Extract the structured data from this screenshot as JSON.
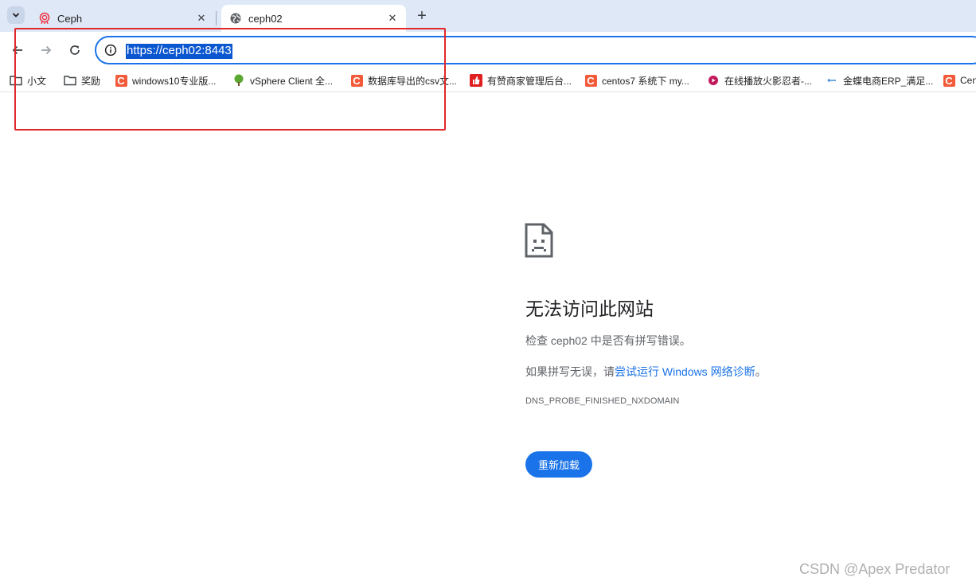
{
  "tabs": [
    {
      "title": "Ceph",
      "favicon": "ceph-icon",
      "active": false
    },
    {
      "title": "ceph02",
      "favicon": "globe-icon",
      "active": true
    }
  ],
  "tab_close_glyph": "✕",
  "new_tab_glyph": "+",
  "toolbar": {
    "url": "https://ceph02:8443",
    "security_icon": "info-icon"
  },
  "bookmarks": [
    {
      "label": "小文",
      "icon": "folder-icon"
    },
    {
      "label": "奖励",
      "icon": "folder-icon"
    },
    {
      "label": "windows10专业版...",
      "icon": "csdn-c-icon"
    },
    {
      "label": "vSphere Client 全...",
      "icon": "tree-icon"
    },
    {
      "label": "数据库导出的csv文...",
      "icon": "csdn-c-icon"
    },
    {
      "label": "有赞商家管理后台...",
      "icon": "thumbs-up-icon"
    },
    {
      "label": "centos7 系统下 my...",
      "icon": "csdn-c-icon"
    },
    {
      "label": "在线播放火影忍者-...",
      "icon": "play-icon"
    },
    {
      "label": "金蝶电商ERP_满足...",
      "icon": "erp-icon"
    },
    {
      "label": "Cen",
      "icon": "csdn-c-icon"
    }
  ],
  "error": {
    "icon": "sad-document-icon",
    "title": "无法访问此网站",
    "check_text": "检查 ceph02 中是否有拼写错误。",
    "suggest_prefix": "如果拼写无误，请",
    "suggest_link": "尝试运行 Windows 网络诊断",
    "suggest_suffix": "。",
    "code": "DNS_PROBE_FINISHED_NXDOMAIN",
    "reload_label": "重新加载"
  },
  "colors": {
    "accent": "#1a73e8",
    "annotation": "#e0272a",
    "csdn_red": "#f35a3a"
  },
  "watermark": "CSDN @Apex   Predator"
}
